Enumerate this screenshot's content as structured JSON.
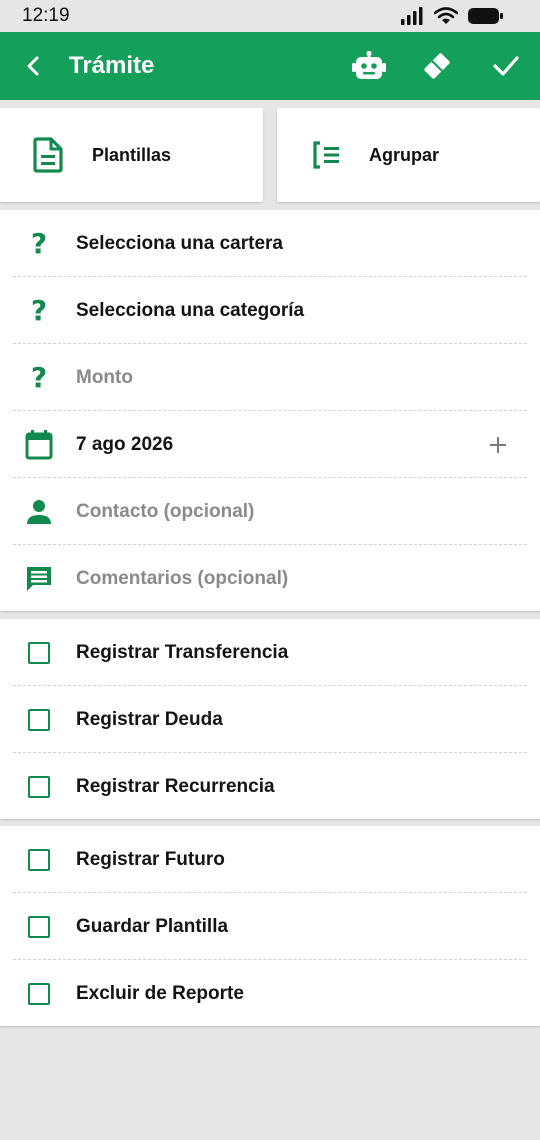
{
  "status_bar": {
    "time": "12:19"
  },
  "app_bar": {
    "title": "Trámite"
  },
  "tiles": {
    "templates_label": "Plantillas",
    "group_label": "Agrupar"
  },
  "fields": {
    "wallet": "Selecciona una cartera",
    "category": "Selecciona una categoría",
    "amount_placeholder": "Monto",
    "date": "7 ago 2026",
    "contact_placeholder": "Contacto (opcional)",
    "comments_placeholder": "Comentarios (opcional)"
  },
  "options_group_1": [
    {
      "label": "Registrar Transferencia",
      "checked": false
    },
    {
      "label": "Registrar Deuda",
      "checked": false
    },
    {
      "label": "Registrar Recurrencia",
      "checked": false
    }
  ],
  "options_group_2": [
    {
      "label": "Registrar Futuro",
      "checked": false
    },
    {
      "label": "Guardar Plantilla",
      "checked": false
    },
    {
      "label": "Excluir de Reporte",
      "checked": false
    }
  ],
  "colors": {
    "primary": "#14a05a",
    "accent_icon": "#138a4d",
    "muted_text": "#8a8a8a",
    "background": "#e6e6e6"
  },
  "icons": [
    "back-arrow-icon",
    "robot-icon",
    "eraser-icon",
    "check-icon",
    "document-icon",
    "group-list-icon",
    "question-icon",
    "calendar-icon",
    "plus-icon",
    "person-icon",
    "comment-icon",
    "checkbox-icon"
  ]
}
